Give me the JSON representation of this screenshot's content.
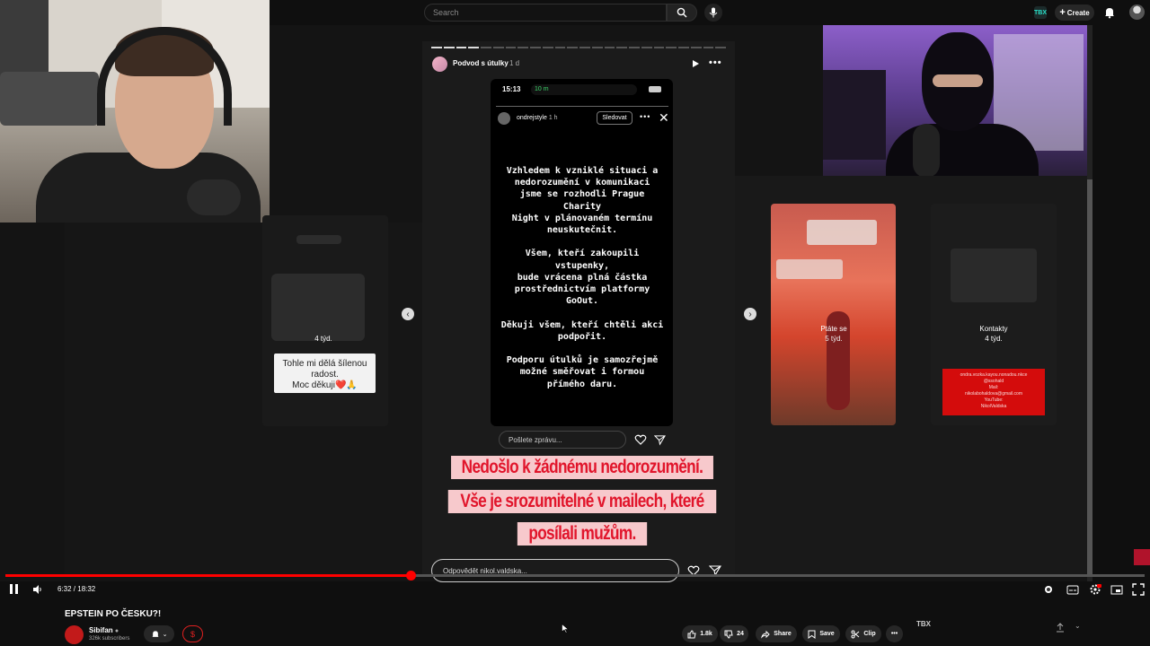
{
  "header": {
    "search_placeholder": "Search",
    "create_label": "Create",
    "ext_badge": "TBX"
  },
  "story": {
    "account": "Podvod s útulky",
    "age": "1 d",
    "progress_done": 4,
    "progress_total": 24,
    "phone": {
      "clock": "15:13",
      "call": "10 m",
      "inner_account": "ondrejstyle",
      "inner_age": "1 h",
      "follow_label": "Sledovat",
      "text": "Vzhledem k vzniklé situaci a\nnedorozumění v komunikaci\njsme se rozhodli Prague Charity\nNight v plánovaném termínu\nneuskutečnit.\n\nVšem, kteří zakoupili vstupenky,\nbude vrácena plná částka\nprostřednictvím platformy\nGoOut.\n\nDěkuji všem, kteří chtěli akci\npodpořit.\n\nPodporu útulků je samozřejmě\nmožné směřovat i formou\npřímého daru.",
      "reply_placeholder": "Pošlete zprávu..."
    },
    "caption": [
      "Nedošlo k žádnému nedorozumění.",
      "Vše je srozumitelné v mailech, které",
      "posílali mužům."
    ],
    "reply_placeholder": "Odpovědět nikol.valdska..."
  },
  "side_stories": {
    "left": {
      "time": "4 týd.",
      "sticker": "Tohle mi dělá šílenou\nradost.\nMoc děkuji❤️🙏"
    },
    "mid": {
      "title": "Ptáte se",
      "time": "5 týd."
    },
    "right": {
      "title": "Kontakty",
      "time": "4 týd.",
      "red_box": "ondra.vozka.kayou.nonadou.nkce\n@ssohald\nMail:\nnikolabohaldova@gmail.com\nYouTube:\nNikolValdska"
    }
  },
  "player": {
    "time": "6:32 / 18:32",
    "progress_fraction": 0.356
  },
  "video": {
    "title": "EPSTEIN PO ČESKU?!",
    "channel": "Sibifan",
    "subscribers": "326k subscribers",
    "likes": "1.8k",
    "dislikes": "24",
    "share_label": "Share",
    "save_label": "Save",
    "clip_label": "Clip",
    "side_logo": "TBX"
  },
  "colors": {
    "accent": "#ff0000",
    "caption_text": "#e1152b",
    "caption_bg": "#f7c9cc",
    "background": "#0f0f0f"
  }
}
